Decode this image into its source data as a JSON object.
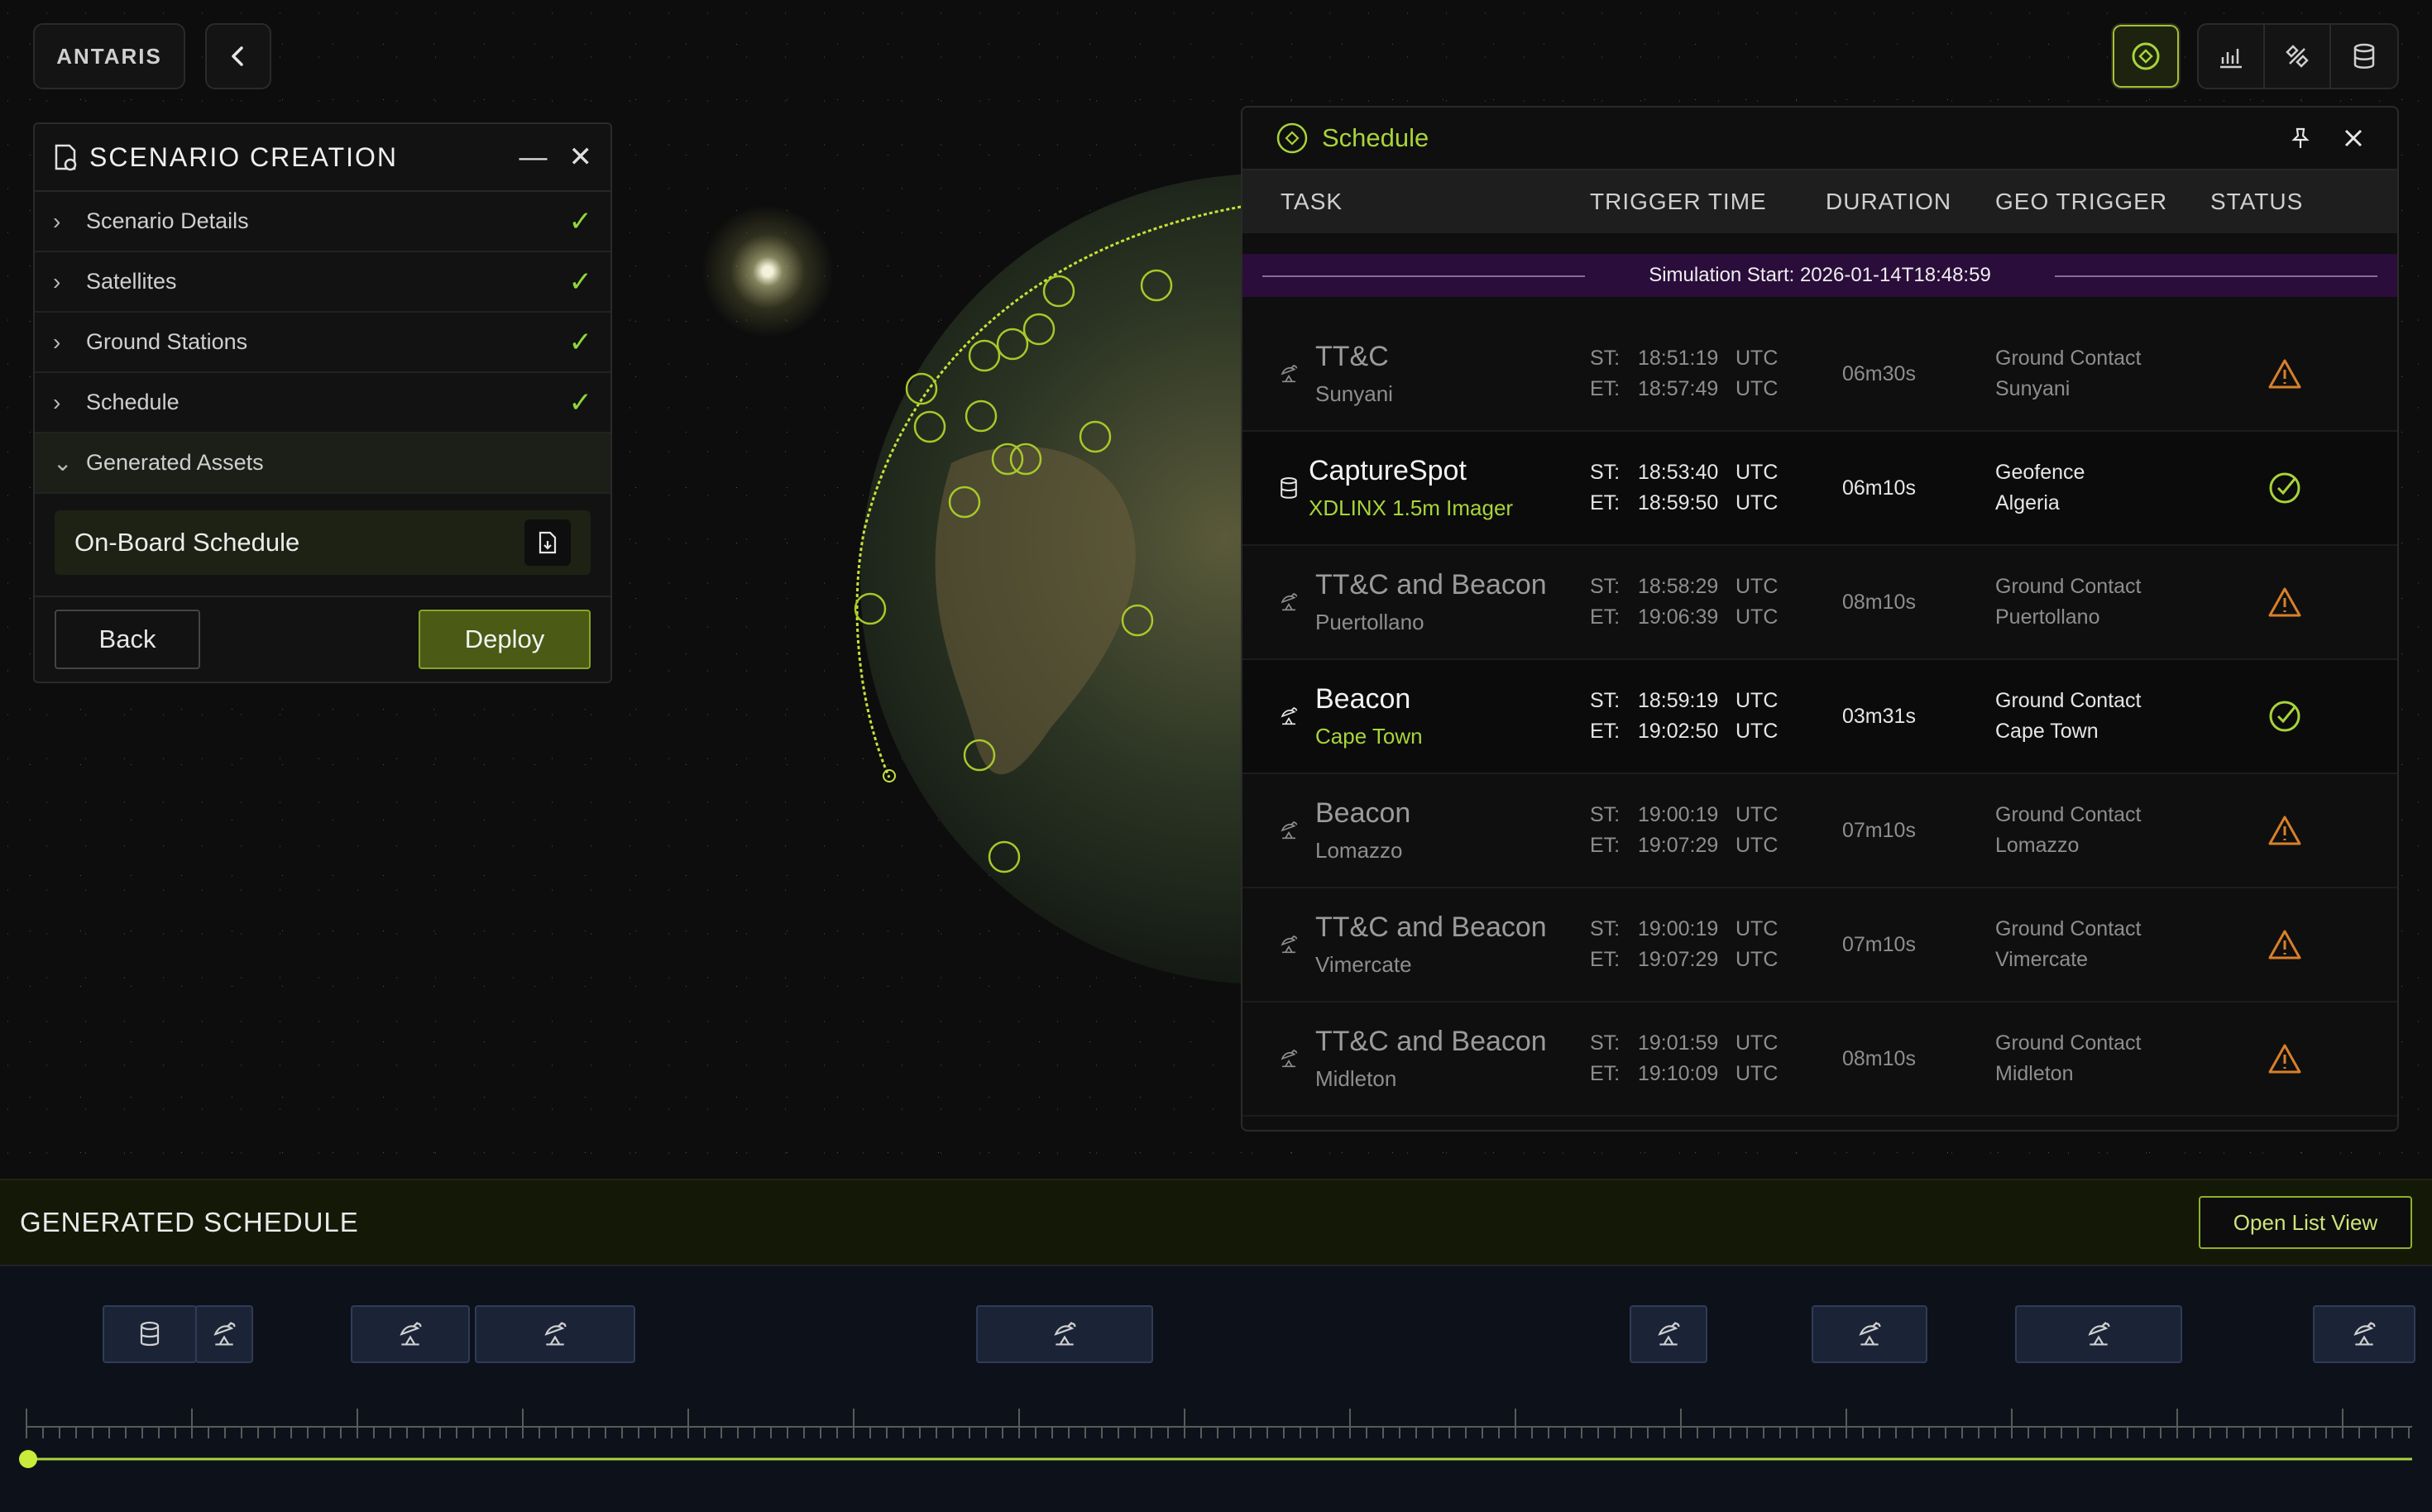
{
  "logo": {
    "text": "ANTARIS"
  },
  "scenario": {
    "title": "SCENARIO CREATION",
    "steps": [
      {
        "label": "Scenario Details"
      },
      {
        "label": "Satellites"
      },
      {
        "label": "Ground Stations"
      },
      {
        "label": "Schedule"
      },
      {
        "label": "Generated Assets"
      }
    ],
    "asset": {
      "label": "On-Board Schedule"
    },
    "back_label": "Back",
    "deploy_label": "Deploy"
  },
  "schedule": {
    "title": "Schedule",
    "columns": {
      "task": "TASK",
      "trigger": "TRIGGER TIME",
      "duration": "DURATION",
      "geo": "GEO TRIGGER",
      "status": "STATUS"
    },
    "sim_start": "Simulation Start: 2026-01-14T18:48:59",
    "st_label": "ST:",
    "et_label": "ET:",
    "utc": "UTC",
    "rows": [
      {
        "name": "TT&C",
        "sub": "Sunyani",
        "st": "18:51:19",
        "et": "18:57:49",
        "duration": "06m30s",
        "geo_type": "Ground Contact",
        "geo_place": "Sunyani",
        "status": "warning"
      },
      {
        "name": "CaptureSpot",
        "sub": "XDLINX 1.5m Imager",
        "st": "18:53:40",
        "et": "18:59:50",
        "duration": "06m10s",
        "geo_type": "Geofence",
        "geo_place": "Algeria",
        "status": "ok"
      },
      {
        "name": "TT&C and Beacon",
        "sub": "Puertollano",
        "st": "18:58:29",
        "et": "19:06:39",
        "duration": "08m10s",
        "geo_type": "Ground Contact",
        "geo_place": "Puertollano",
        "status": "warning"
      },
      {
        "name": "Beacon",
        "sub": "Cape Town",
        "st": "18:59:19",
        "et": "19:02:50",
        "duration": "03m31s",
        "geo_type": "Ground Contact",
        "geo_place": "Cape Town",
        "status": "ok"
      },
      {
        "name": "Beacon",
        "sub": "Lomazzo",
        "st": "19:00:19",
        "et": "19:07:29",
        "duration": "07m10s",
        "geo_type": "Ground Contact",
        "geo_place": "Lomazzo",
        "status": "warning"
      },
      {
        "name": "TT&C and Beacon",
        "sub": "Vimercate",
        "st": "19:00:19",
        "et": "19:07:29",
        "duration": "07m10s",
        "geo_type": "Ground Contact",
        "geo_place": "Vimercate",
        "status": "warning"
      },
      {
        "name": "TT&C and Beacon",
        "sub": "Midleton",
        "st": "19:01:59",
        "et": "19:10:09",
        "duration": "08m10s",
        "geo_type": "Ground Contact",
        "geo_place": "Midleton",
        "status": "warning"
      }
    ]
  },
  "generated": {
    "title": "GENERATED SCHEDULE",
    "open_list_label": "Open List View"
  },
  "colors": {
    "accent": "#a8d43a",
    "warning": "#d9802a",
    "ok": "#a8d43a",
    "deploy": "#4b5a14"
  },
  "icons": [
    "back-chevron-icon",
    "satellite-schedule-icon",
    "chart-icon",
    "satellite-icon",
    "database-icon",
    "pin-icon",
    "close-icon",
    "minimize-icon",
    "download-file-icon",
    "ground-antenna-icon",
    "warning-icon",
    "check-circle-icon"
  ]
}
